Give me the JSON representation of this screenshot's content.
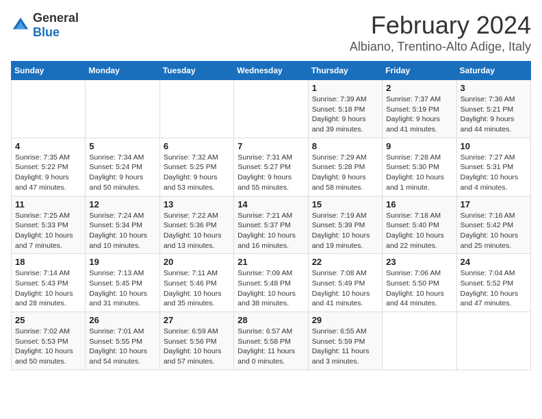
{
  "header": {
    "logo": {
      "general": "General",
      "blue": "Blue"
    },
    "title": "February 2024",
    "subtitle": "Albiano, Trentino-Alto Adige, Italy"
  },
  "calendar": {
    "days_of_week": [
      "Sunday",
      "Monday",
      "Tuesday",
      "Wednesday",
      "Thursday",
      "Friday",
      "Saturday"
    ],
    "weeks": [
      [
        {
          "day": "",
          "info": ""
        },
        {
          "day": "",
          "info": ""
        },
        {
          "day": "",
          "info": ""
        },
        {
          "day": "",
          "info": ""
        },
        {
          "day": "1",
          "info": "Sunrise: 7:39 AM\nSunset: 5:18 PM\nDaylight: 9 hours and 39 minutes."
        },
        {
          "day": "2",
          "info": "Sunrise: 7:37 AM\nSunset: 5:19 PM\nDaylight: 9 hours and 41 minutes."
        },
        {
          "day": "3",
          "info": "Sunrise: 7:36 AM\nSunset: 5:21 PM\nDaylight: 9 hours and 44 minutes."
        }
      ],
      [
        {
          "day": "4",
          "info": "Sunrise: 7:35 AM\nSunset: 5:22 PM\nDaylight: 9 hours and 47 minutes."
        },
        {
          "day": "5",
          "info": "Sunrise: 7:34 AM\nSunset: 5:24 PM\nDaylight: 9 hours and 50 minutes."
        },
        {
          "day": "6",
          "info": "Sunrise: 7:32 AM\nSunset: 5:25 PM\nDaylight: 9 hours and 53 minutes."
        },
        {
          "day": "7",
          "info": "Sunrise: 7:31 AM\nSunset: 5:27 PM\nDaylight: 9 hours and 55 minutes."
        },
        {
          "day": "8",
          "info": "Sunrise: 7:29 AM\nSunset: 5:28 PM\nDaylight: 9 hours and 58 minutes."
        },
        {
          "day": "9",
          "info": "Sunrise: 7:28 AM\nSunset: 5:30 PM\nDaylight: 10 hours and 1 minute."
        },
        {
          "day": "10",
          "info": "Sunrise: 7:27 AM\nSunset: 5:31 PM\nDaylight: 10 hours and 4 minutes."
        }
      ],
      [
        {
          "day": "11",
          "info": "Sunrise: 7:25 AM\nSunset: 5:33 PM\nDaylight: 10 hours and 7 minutes."
        },
        {
          "day": "12",
          "info": "Sunrise: 7:24 AM\nSunset: 5:34 PM\nDaylight: 10 hours and 10 minutes."
        },
        {
          "day": "13",
          "info": "Sunrise: 7:22 AM\nSunset: 5:36 PM\nDaylight: 10 hours and 13 minutes."
        },
        {
          "day": "14",
          "info": "Sunrise: 7:21 AM\nSunset: 5:37 PM\nDaylight: 10 hours and 16 minutes."
        },
        {
          "day": "15",
          "info": "Sunrise: 7:19 AM\nSunset: 5:39 PM\nDaylight: 10 hours and 19 minutes."
        },
        {
          "day": "16",
          "info": "Sunrise: 7:18 AM\nSunset: 5:40 PM\nDaylight: 10 hours and 22 minutes."
        },
        {
          "day": "17",
          "info": "Sunrise: 7:16 AM\nSunset: 5:42 PM\nDaylight: 10 hours and 25 minutes."
        }
      ],
      [
        {
          "day": "18",
          "info": "Sunrise: 7:14 AM\nSunset: 5:43 PM\nDaylight: 10 hours and 28 minutes."
        },
        {
          "day": "19",
          "info": "Sunrise: 7:13 AM\nSunset: 5:45 PM\nDaylight: 10 hours and 31 minutes."
        },
        {
          "day": "20",
          "info": "Sunrise: 7:11 AM\nSunset: 5:46 PM\nDaylight: 10 hours and 35 minutes."
        },
        {
          "day": "21",
          "info": "Sunrise: 7:09 AM\nSunset: 5:48 PM\nDaylight: 10 hours and 38 minutes."
        },
        {
          "day": "22",
          "info": "Sunrise: 7:08 AM\nSunset: 5:49 PM\nDaylight: 10 hours and 41 minutes."
        },
        {
          "day": "23",
          "info": "Sunrise: 7:06 AM\nSunset: 5:50 PM\nDaylight: 10 hours and 44 minutes."
        },
        {
          "day": "24",
          "info": "Sunrise: 7:04 AM\nSunset: 5:52 PM\nDaylight: 10 hours and 47 minutes."
        }
      ],
      [
        {
          "day": "25",
          "info": "Sunrise: 7:02 AM\nSunset: 5:53 PM\nDaylight: 10 hours and 50 minutes."
        },
        {
          "day": "26",
          "info": "Sunrise: 7:01 AM\nSunset: 5:55 PM\nDaylight: 10 hours and 54 minutes."
        },
        {
          "day": "27",
          "info": "Sunrise: 6:59 AM\nSunset: 5:56 PM\nDaylight: 10 hours and 57 minutes."
        },
        {
          "day": "28",
          "info": "Sunrise: 6:57 AM\nSunset: 5:58 PM\nDaylight: 11 hours and 0 minutes."
        },
        {
          "day": "29",
          "info": "Sunrise: 6:55 AM\nSunset: 5:59 PM\nDaylight: 11 hours and 3 minutes."
        },
        {
          "day": "",
          "info": ""
        },
        {
          "day": "",
          "info": ""
        }
      ]
    ]
  }
}
